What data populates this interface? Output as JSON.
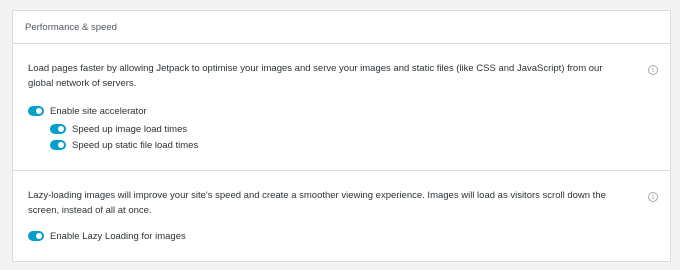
{
  "card": {
    "title": "Performance & speed"
  },
  "site_accelerator": {
    "description": "Load pages faster by allowing Jetpack to optimise your images and serve your images and static files (like CSS and JavaScript) from our global network of servers.",
    "main_toggle": {
      "label": "Enable site accelerator",
      "enabled": true
    },
    "sub_toggles": [
      {
        "label": "Speed up image load times",
        "enabled": true
      },
      {
        "label": "Speed up static file load times",
        "enabled": true
      }
    ],
    "info_icon": "info-icon"
  },
  "lazy_loading": {
    "description": "Lazy-loading images will improve your site's speed and create a smoother viewing experience. Images will load as visitors scroll down the screen, instead of all at once.",
    "toggle": {
      "label": "Enable Lazy Loading for images",
      "enabled": true
    },
    "info_icon": "info-icon"
  },
  "colors": {
    "toggle_on": "#069ecf",
    "border": "#dcdcde",
    "background": "#f3f3f4"
  }
}
